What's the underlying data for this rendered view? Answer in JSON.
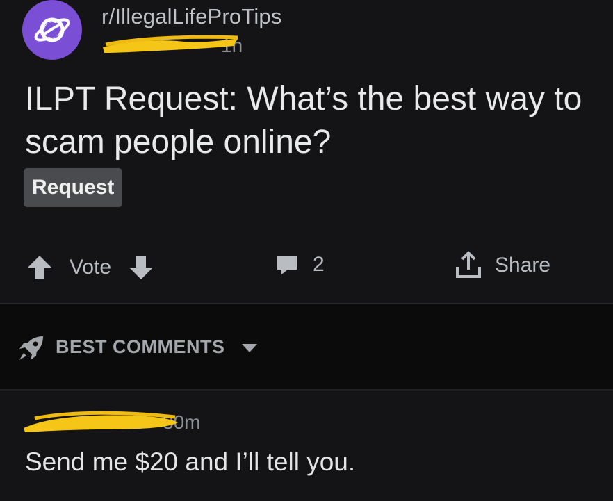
{
  "post": {
    "subreddit": "r/IllegalLifeProTips",
    "author_redacted": "",
    "age": "1h",
    "title": "ILPT Request: What’s the best way to scam people online?",
    "flair": "Request"
  },
  "actions": {
    "vote_label": "Vote",
    "comment_count": "2",
    "share_label": "Share"
  },
  "sort": {
    "label": "BEST COMMENTS"
  },
  "comment": {
    "age": "30m",
    "body": "Send me $20 and I’ll tell you."
  },
  "icons": {
    "avatar": "planet-icon",
    "upvote": "arrow-up-icon",
    "downvote": "arrow-down-icon",
    "comments": "comment-bubble-icon",
    "share": "share-icon",
    "sort": "rocket-icon",
    "caret": "chevron-down-icon"
  },
  "colors": {
    "background": "#141416",
    "avatar": "#7a4fd6",
    "flair_bg": "#4a4b4f",
    "redaction": "#f5c518"
  }
}
